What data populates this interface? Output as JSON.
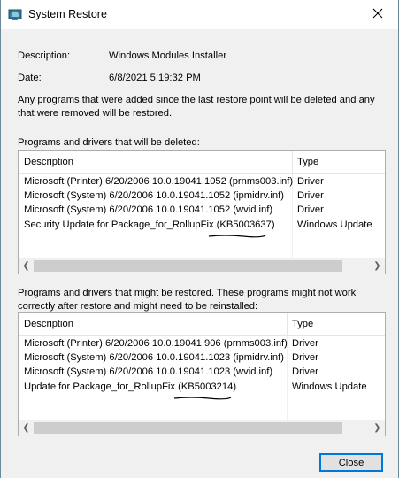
{
  "window": {
    "title": "System Restore"
  },
  "info": {
    "description_label": "Description:",
    "description_value": "Windows Modules Installer",
    "date_label": "Date:",
    "date_value": "6/8/2021 5:19:32 PM",
    "note": "Any programs that were added since the last restore point will be deleted and any that were removed will be restored."
  },
  "deleted": {
    "title": "Programs and drivers that will be deleted:",
    "columns": {
      "description": "Description",
      "type": "Type"
    },
    "rows": [
      {
        "description": "Microsoft (Printer) 6/20/2006 10.0.19041.1052 (prnms003.inf)",
        "type": "Driver"
      },
      {
        "description": "Microsoft (System) 6/20/2006 10.0.19041.1052 (ipmidrv.inf)",
        "type": "Driver"
      },
      {
        "description": "Microsoft (System) 6/20/2006 10.0.19041.1052 (wvid.inf)",
        "type": "Driver"
      },
      {
        "description": "Security Update for Package_for_RollupFix (KB5003637)",
        "type": "Windows Update"
      }
    ]
  },
  "restored": {
    "title": "Programs and drivers that might be restored. These programs might not work correctly after restore and might need to be reinstalled:",
    "columns": {
      "description": "Description",
      "type": "Type"
    },
    "rows": [
      {
        "description": "Microsoft (Printer) 6/20/2006 10.0.19041.906 (prnms003.inf)",
        "type": "Driver"
      },
      {
        "description": "Microsoft (System) 6/20/2006 10.0.19041.1023 (ipmidrv.inf)",
        "type": "Driver"
      },
      {
        "description": "Microsoft (System) 6/20/2006 10.0.19041.1023 (wvid.inf)",
        "type": "Driver"
      },
      {
        "description": "Update for Package_for_RollupFix (KB5003214)",
        "type": "Windows Update"
      }
    ]
  },
  "buttons": {
    "close_label": "Close"
  },
  "icons": {
    "app": "system-restore-icon",
    "close": "close-icon",
    "scroll_left": "scroll-left-icon",
    "scroll_right": "scroll-right-icon"
  },
  "colors": {
    "accent": "#0078d7",
    "annotation_ink": "#000000"
  }
}
